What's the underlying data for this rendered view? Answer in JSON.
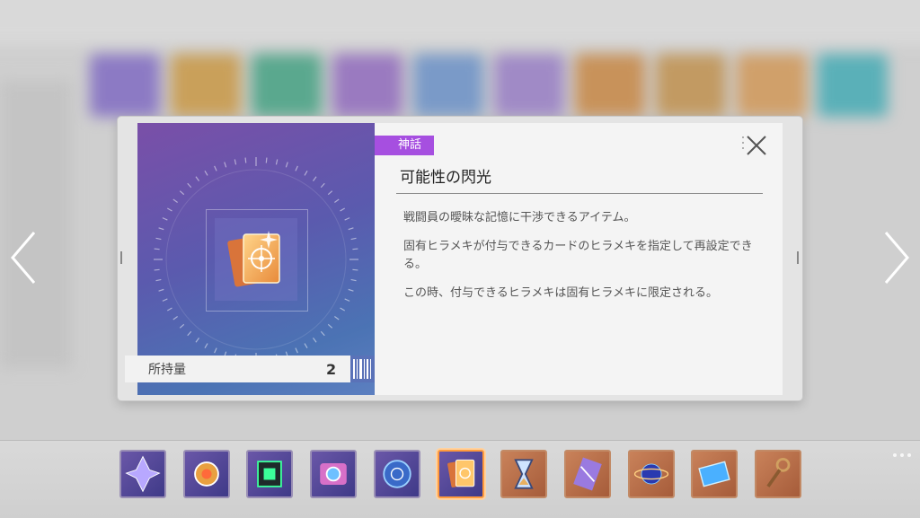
{
  "item": {
    "rarity": "神話",
    "name": "可能性の閃光",
    "description": [
      "戦闘員の曖昧な記憶に干渉できるアイテム。",
      "固有ヒラメキが付与できるカードのヒラメキを指定して再設定できる。",
      "この時、付与できるヒラメキは固有ヒラメキに限定される。"
    ],
    "owned_label": "所持量",
    "owned_count": "2"
  },
  "colors": {
    "rarity_accent": "#a64fe0",
    "selection_border": "#ff9a3c"
  },
  "inventory": {
    "items": [
      {
        "icon": "crystal-shard-icon",
        "frame": "purple"
      },
      {
        "icon": "golden-orb-icon",
        "frame": "purple"
      },
      {
        "icon": "green-cube-icon",
        "frame": "purple"
      },
      {
        "icon": "camera-icon",
        "frame": "purple"
      },
      {
        "icon": "blue-disc-icon",
        "frame": "purple"
      },
      {
        "icon": "card-pack-icon",
        "frame": "purple",
        "selected": true
      },
      {
        "icon": "hourglass-icon",
        "frame": "orange"
      },
      {
        "icon": "scroll-icon",
        "frame": "orange"
      },
      {
        "icon": "planet-icon",
        "frame": "orange"
      },
      {
        "icon": "blueprint-icon",
        "frame": "orange"
      },
      {
        "icon": "chain-key-icon",
        "frame": "orange"
      }
    ]
  }
}
